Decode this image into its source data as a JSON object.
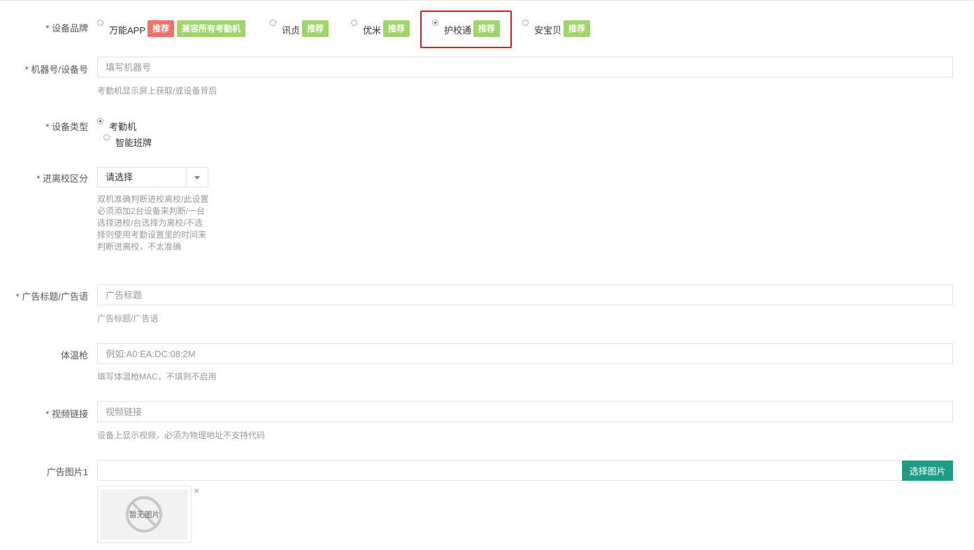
{
  "brand": {
    "label": "* 设备品牌",
    "options": [
      {
        "name": "万能APP",
        "checked": false,
        "badges": [
          {
            "text": "推荐",
            "color": "#f0726b"
          },
          {
            "text": "兼容所有考勤机",
            "color": "#9fd66a"
          }
        ]
      },
      {
        "name": "讯贞",
        "checked": false,
        "badges": [
          {
            "text": "推荐",
            "color": "#9fd66a"
          }
        ]
      },
      {
        "name": "优米",
        "checked": false,
        "badges": [
          {
            "text": "推荐",
            "color": "#9fd66a"
          }
        ]
      },
      {
        "name": "护校通",
        "checked": true,
        "badges": [
          {
            "text": "推荐",
            "color": "#9fd66a"
          }
        ]
      },
      {
        "name": "安宝贝",
        "checked": false,
        "badges": [
          {
            "text": "推荐",
            "color": "#9fd66a"
          }
        ]
      }
    ]
  },
  "machine": {
    "label": "* 机器号/设备号",
    "placeholder": "填写机器号",
    "help": "考勤机显示屏上获取/或设备背后"
  },
  "device_type": {
    "label": "* 设备类型",
    "options": [
      {
        "name": "考勤机",
        "checked": true
      },
      {
        "name": "智能班牌",
        "checked": false
      }
    ]
  },
  "campus": {
    "label": "* 进离校区分",
    "value": "请选择",
    "help": "双机准确判断进校离校/此设置必须添加2台设备来判断/一台选择进校/台选择为离校/不选择则使用考勤设置里的时间来判断进离校，不太准确"
  },
  "ad_title": {
    "label": "* 广告标题/广告语",
    "placeholder": "广告标题",
    "help": "广告标题/广告语"
  },
  "thermo": {
    "label": "体温枪",
    "placeholder": "例如:A0:EA:DC:08:2M",
    "help": "填写体温枪MAC，不填则不启用"
  },
  "video": {
    "label": "* 视频链接",
    "placeholder": "视频链接",
    "help": "设备上显示视频，必须为物理地址不支持代码"
  },
  "ad_image": {
    "label": "广告图片1",
    "value": "",
    "button": "选择图片",
    "no_image": "暂无图片",
    "remove": "×"
  },
  "colors": {
    "accent": "#1e9c84",
    "highlight": "#e8141e",
    "badge_red": "#f0726b",
    "badge_green": "#9fd66a"
  }
}
